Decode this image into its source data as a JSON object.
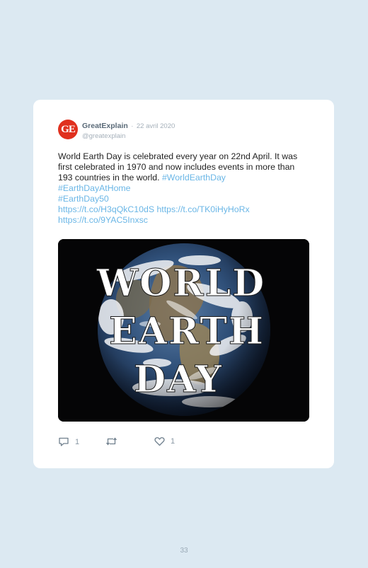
{
  "tweet": {
    "author_name": "GreatExplain",
    "separator": "·",
    "date": "22 avril 2020",
    "handle": "@greatexplain",
    "avatar_text": "GE",
    "text": "World Earth Day is celebrated every year on 22nd April. It was first celebrated in 1970 and now includes events in more than 193 countries in the world.",
    "hashtags": [
      "#WorldEarthDay",
      "#EarthDayAtHome",
      "#EarthDay50"
    ],
    "links": [
      "https://t.co/H3qQkC10dS",
      "https://t.co/TK0iHyHoRx",
      "https://t.co/9YAC5Inxsc"
    ],
    "image_text": [
      "WORLD",
      "EARTH",
      "DAY"
    ],
    "actions": {
      "reply_count": "1",
      "like_count": "1",
      "icons": [
        "comment-icon",
        "retweet-icon",
        "heart-icon"
      ]
    }
  },
  "page_number": "33",
  "colors": {
    "background": "#dce9f2",
    "card": "#ffffff",
    "link": "#6ab6e6",
    "avatar": "#e0301e"
  }
}
